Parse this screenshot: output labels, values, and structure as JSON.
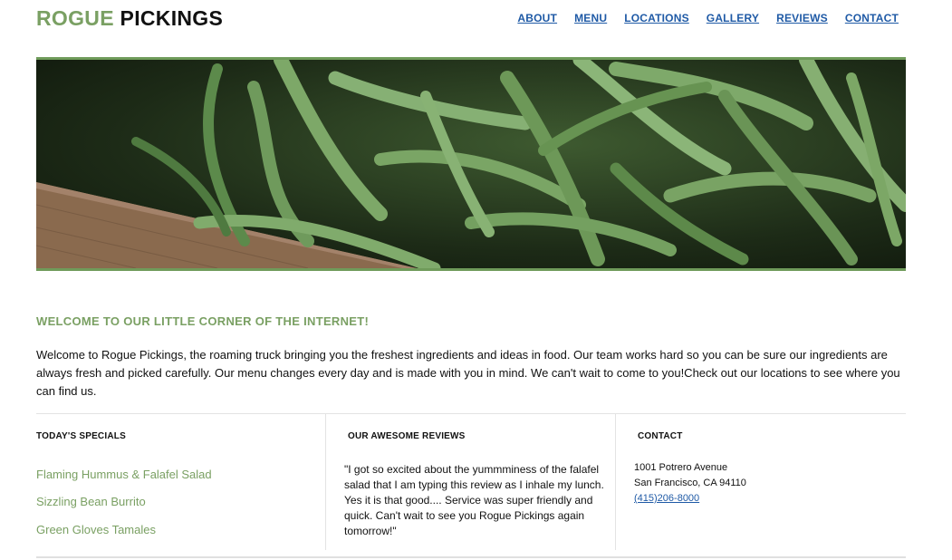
{
  "brand": {
    "part1": "ROGUE",
    "part2": "PICKINGS"
  },
  "nav": {
    "items": [
      "ABOUT",
      "MENU",
      "LOCATIONS",
      "GALLERY",
      "REVIEWS",
      "CONTACT"
    ]
  },
  "hero": {
    "image": "green-beans-photo"
  },
  "welcome": {
    "title": "WELCOME TO OUR LITTLE CORNER OF THE INTERNET!",
    "text": "Welcome to Rogue Pickings, the roaming truck bringing you the freshest ingredients and ideas in food. Our team works hard so you can be sure our ingredients are always fresh and picked carefully. Our menu changes every day and is made with you in mind. We can't wait to come to you!Check out our locations to see where you can find us."
  },
  "specials": {
    "heading": "TODAY'S SPECIALS",
    "items": [
      "Flaming Hummus & Falafel Salad",
      "Sizzling Bean Burrito",
      "Green Gloves Tamales"
    ]
  },
  "reviews": {
    "heading": "OUR AWESOME REVIEWS",
    "quote": "\"I got so excited about the yummminess of the falafel salad that I am typing this review as I inhale my lunch. Yes it is that good.... Service was super friendly and quick. Can't wait to see you Rogue Pickings again tomorrow!\""
  },
  "contact": {
    "heading": "CONTACT",
    "address1": "1001 Potrero Avenue",
    "address2": "San Francisco, CA 94110",
    "phone": "(415)206-8000"
  },
  "colors": {
    "accent": "#7aa063",
    "link": "#1f5aa6",
    "text": "#111111"
  }
}
